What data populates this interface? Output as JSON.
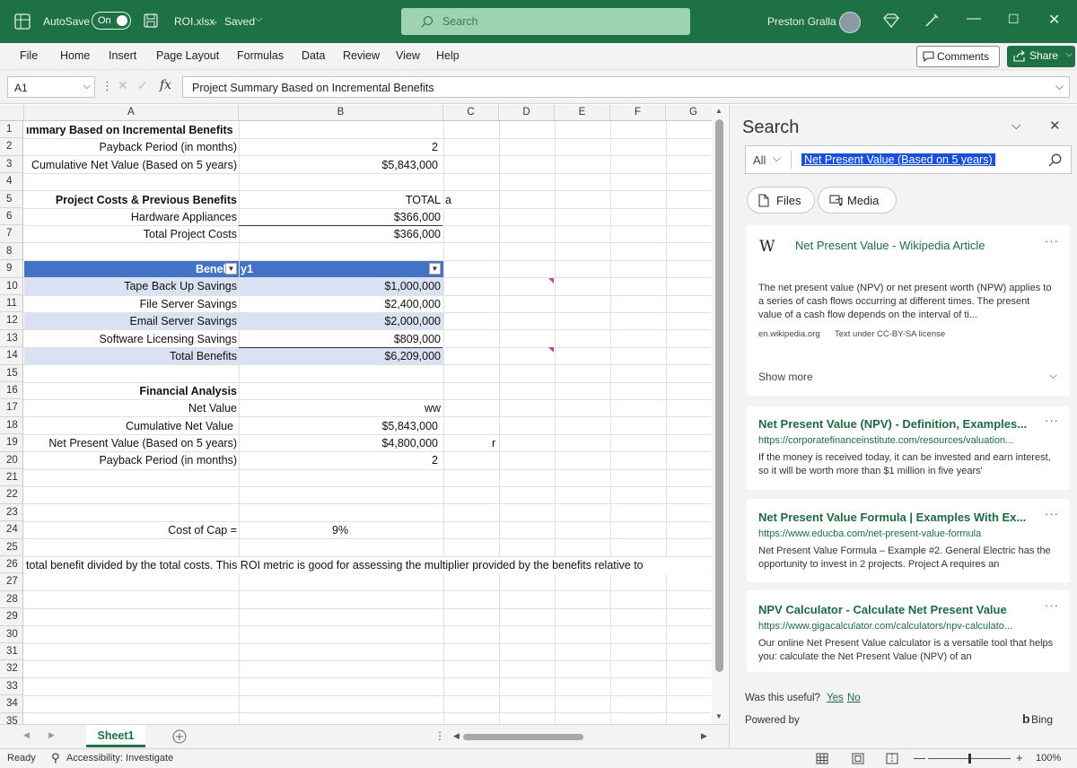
{
  "titlebar": {
    "autosave_label": "AutoSave",
    "autosave_state": "On",
    "file_name": "ROI.xlsx",
    "saved_status": "Saved",
    "search_placeholder": "Search",
    "user_name": "Preston Gralla"
  },
  "menu": {
    "items": [
      "File",
      "Home",
      "Insert",
      "Page Layout",
      "Formulas",
      "Data",
      "Review",
      "View",
      "Help"
    ],
    "comments_label": "Comments",
    "share_label": "Share"
  },
  "formula_bar": {
    "name_box": "A1",
    "fx": "fx",
    "formula": "Project Summary Based on Incremental Benefits"
  },
  "sheet": {
    "columns": [
      "A",
      "B",
      "C",
      "D",
      "E",
      "F",
      "G"
    ],
    "rows": [
      "1",
      "2",
      "3",
      "4",
      "5",
      "6",
      "7",
      "8",
      "9",
      "10",
      "11",
      "12",
      "13",
      "14",
      "15",
      "16",
      "17",
      "18",
      "19",
      "20",
      "21",
      "22",
      "23",
      "24",
      "25",
      "26",
      "27",
      "28",
      "29",
      "30",
      "31",
      "32",
      "33",
      "34",
      "35"
    ],
    "r1_a": "ımmary Based on Incremental Benefits",
    "r2_a": "Payback Period (in months)",
    "r2_b": "2",
    "r3_a": "Cumulative Net Value  (Based on 5 years)",
    "r3_b": "$5,843,000",
    "r5_a": "Project Costs & Previous Benefits",
    "r5_b": "TOTAL",
    "r5_c": "a",
    "r6_a": "Hardware Appliances",
    "r6_b": "$366,000",
    "r7_a": "Total Project Costs",
    "r7_b": "$366,000",
    "r9_a": "Benel",
    "r9_b": "y1",
    "r10_a": "Tape Back Up Savings",
    "r10_b": "$1,000,000",
    "r11_a": "File Server Savings",
    "r11_b": "$2,400,000",
    "r12_a": "Email Server Savings",
    "r12_b": "$2,000,000",
    "r13_a": "Software Licensing Savings",
    "r13_b": "$809,000",
    "r14_a": "Total Benefits",
    "r14_b": "$6,209,000",
    "r16_a": "Financial Analysis",
    "r17_a": "Net Value",
    "r17_b": "ww",
    "r18_a": "Cumulative Net Value",
    "r18_b": "$5,843,000",
    "r19_a": "Net Present Value (Based on 5 years)",
    "r19_b": "$4,800,000",
    "r19_c": "r",
    "r20_a": "Payback Period (in months)",
    "r20_b": "2",
    "r24_a": "Cost of Cap =",
    "r24_b": "9%",
    "r26_a": "total benefit divided by the total costs.  This ROI metric is good for assessing the multiplier provided by the benefits relative to",
    "sheet_tab": "Sheet1"
  },
  "status": {
    "ready": "Ready",
    "accessibility": "Accessibility: Investigate",
    "zoom": "100%"
  },
  "pane": {
    "title": "Search",
    "scope": "All",
    "query": "Net Present Value (Based on 5 years)",
    "chip_files": "Files",
    "chip_media": "Media",
    "results": [
      {
        "title": "Net Present Value - Wikipedia Article",
        "text": "The net present value (NPV) or net present worth (NPW) applies to a series of cash flows occurring at different times. The present value of a cash flow depends on the interval of ti...",
        "source": "en.wikipedia.org",
        "license": "Text under CC-BY-SA license",
        "show_more": "Show more"
      },
      {
        "title": "Net Present Value (NPV) - Definition, Examples...",
        "url": "https://corporatefinanceinstitute.com/resources/valuation...",
        "text": "If the money is received today, it can be invested and earn interest, so it will be worth more than $1 million in five years'"
      },
      {
        "title": "Net Present Value Formula | Examples With Ex...",
        "url": "https://www.educba.com/net-present-value-formula",
        "text": "Net Present Value Formula – Example #2. General Electric has the opportunity to invest in 2 projects. Project A requires an"
      },
      {
        "title": "NPV Calculator - Calculate Net Present Value",
        "url": "https://www.gigacalculator.com/calculators/npv-calculato...",
        "text": "Our online Net Present Value calculator is a versatile tool that helps you: calculate the Net Present Value (NPV) of an"
      }
    ],
    "useful_q": "Was this useful?",
    "yes": "Yes",
    "no": "No",
    "powered_by": "Powered by",
    "bing": "Bing"
  },
  "colors": {
    "excel_green": "#1e7145",
    "table_header": "#4472c4",
    "table_band": "#d9e1f2",
    "selection": "#1a4fd8"
  },
  "icons": [
    "excel-logo-icon",
    "save-icon",
    "search-icon",
    "diamond-icon",
    "pen-icon",
    "minimize-icon",
    "maximize-icon",
    "close-icon",
    "comment-icon",
    "share-icon",
    "fx-icon",
    "file-icon",
    "media-icon",
    "wikipedia-icon",
    "bing-icon",
    "add-sheet-icon"
  ]
}
